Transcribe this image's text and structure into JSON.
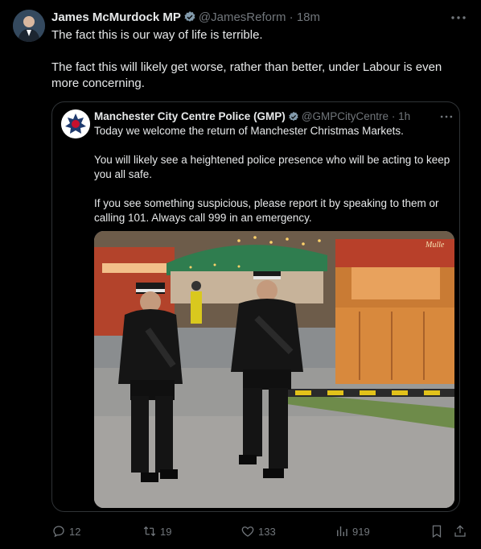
{
  "tweet": {
    "author_name": "James McMurdock MP",
    "handle": "@JamesReform",
    "separator": "·",
    "time": "18m",
    "paragraphs": [
      "The fact this is our way of life is terrible.",
      "The fact this will likely get worse, rather than better, under Labour is even more concerning."
    ],
    "icons": {
      "verified": "verified-badge-icon",
      "more": "more-options-icon"
    }
  },
  "quote": {
    "author_name": "Manchester City Centre Police (GMP)",
    "handle": "@GMPCityCentre",
    "separator": "·",
    "time": "1h",
    "paragraphs": [
      "Today we welcome the return of Manchester Christmas Markets.",
      "You will likely see a heightened police presence who will be acting to keep you all safe.",
      "If you see something suspicious, please report it by speaking to them or calling 101. Always call 999 in an emergency."
    ],
    "image": {
      "shop_sign": "Mulle"
    }
  },
  "actions": {
    "replies": "12",
    "reposts": "19",
    "likes": "133",
    "views": "919"
  },
  "colors": {
    "background": "#000000",
    "text": "#e7e9ea",
    "muted": "#71767b",
    "border": "#2f3336",
    "verified": "#829aab"
  }
}
